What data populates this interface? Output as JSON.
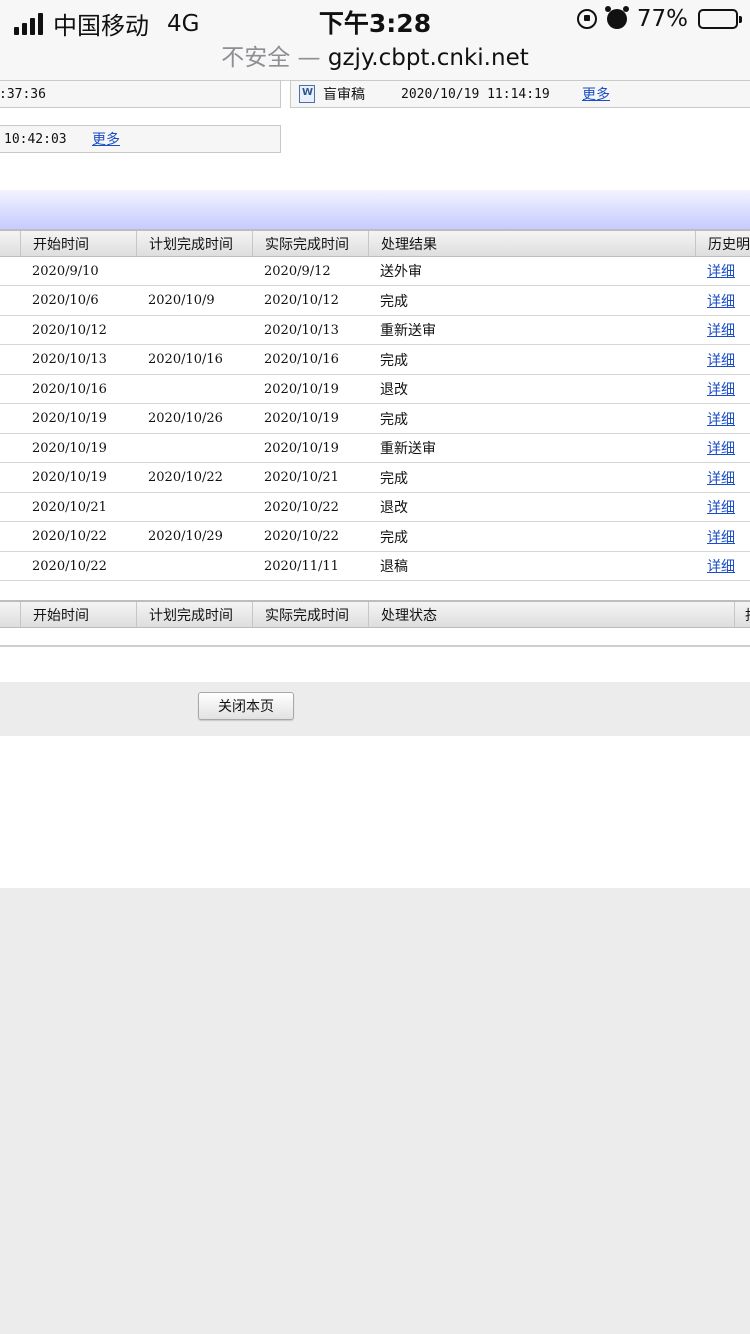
{
  "status_bar": {
    "carrier": "中国移动",
    "network": "4G",
    "time": "下午3:28",
    "battery_percent": "77%",
    "battery_level": 0.77
  },
  "url_bar": {
    "insecure_label": "不安全 —",
    "host": "gzjy.cbpt.cnki.net"
  },
  "documents": {
    "row1_left_time": ":37:36",
    "row1_right_name": "盲审稿",
    "row1_right_time": "2020/10/19 11:14:19",
    "row1_right_more": "更多",
    "row2_left_time": "10:42:03",
    "row2_left_more": "更多"
  },
  "history_table": {
    "headers": [
      "开始时间",
      "计划完成时间",
      "实际完成时间",
      "处理结果",
      "历史明"
    ],
    "rows": [
      {
        "start": "2020/9/10",
        "planned": "",
        "actual": "2020/9/12",
        "result": "送外审",
        "link": "详细"
      },
      {
        "start": "2020/10/6",
        "planned": "2020/10/9",
        "actual": "2020/10/12",
        "result": "完成",
        "link": "详细"
      },
      {
        "start": "2020/10/12",
        "planned": "",
        "actual": "2020/10/13",
        "result": "重新送审",
        "link": "详细"
      },
      {
        "start": "2020/10/13",
        "planned": "2020/10/16",
        "actual": "2020/10/16",
        "result": "完成",
        "link": "详细"
      },
      {
        "start": "2020/10/16",
        "planned": "",
        "actual": "2020/10/19",
        "result": "退改",
        "link": "详细"
      },
      {
        "start": "2020/10/19",
        "planned": "2020/10/26",
        "actual": "2020/10/19",
        "result": "完成",
        "link": "详细"
      },
      {
        "start": "2020/10/19",
        "planned": "",
        "actual": "2020/10/19",
        "result": "重新送审",
        "link": "详细"
      },
      {
        "start": "2020/10/19",
        "planned": "2020/10/22",
        "actual": "2020/10/21",
        "result": "完成",
        "link": "详细"
      },
      {
        "start": "2020/10/21",
        "planned": "",
        "actual": "2020/10/22",
        "result": "退改",
        "link": "详细"
      },
      {
        "start": "2020/10/22",
        "planned": "2020/10/29",
        "actual": "2020/10/22",
        "result": "完成",
        "link": "详细"
      },
      {
        "start": "2020/10/22",
        "planned": "",
        "actual": "2020/11/11",
        "result": "退稿",
        "link": "详细"
      }
    ]
  },
  "current_table": {
    "headers": [
      "开始时间",
      "计划完成时间",
      "实际完成时间",
      "处理状态",
      "抄"
    ]
  },
  "close_button": "关闭本页",
  "colors": {
    "link": "#1a4ec7",
    "gradient_bar": "#c6ccff",
    "page_background": "#ececec"
  }
}
